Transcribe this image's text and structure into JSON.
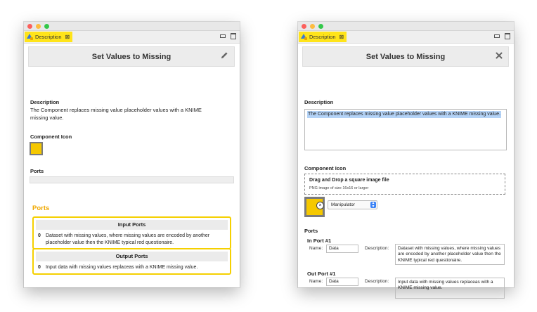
{
  "left_window": {
    "tab": {
      "label": "Description"
    },
    "header": {
      "title": "Set Values to Missing",
      "action_icon": "pencil-icon"
    },
    "description": {
      "label": "Description",
      "text": "The Component replaces missing value placeholder values with a KNIME missing value."
    },
    "component_icon": {
      "label": "Component Icon"
    },
    "ports": {
      "label": "Ports"
    },
    "ports_panel": {
      "title": "Ports",
      "input": {
        "header": "Input Ports",
        "rows": [
          {
            "index": "0",
            "text": "Dataset with missing values, where missing values are encoded by another placeholder value then the KNIME typical red questionaire."
          }
        ]
      },
      "output": {
        "header": "Output Ports",
        "rows": [
          {
            "index": "0",
            "text": "Input data with missing values replaceas with a KNIME missing value."
          }
        ]
      }
    }
  },
  "right_window": {
    "tab": {
      "label": "Description"
    },
    "header": {
      "title": "Set Values to Missing",
      "action_icon": "close-icon"
    },
    "description": {
      "label": "Description",
      "value": "The Component replaces missing value placeholder values with a KNIME missing value."
    },
    "component_icon": {
      "label": "Component Icon",
      "dropzone_title": "Drag and Drop a square image file",
      "dropzone_subtitle": "PNG image of size 16x16 or larger",
      "remove_symbol": "×",
      "type_select": "Manipulator"
    },
    "ports": {
      "label": "Ports",
      "in_port": {
        "title": "In Port #1",
        "name_label": "Name:",
        "name": "Data",
        "description_label": "Description:",
        "description": "Dataset with missing values, where missing values are encoded by another placeholder value then the KNIME typical red questionaire."
      },
      "out_port": {
        "title": "Out Port #1",
        "name_label": "Name:",
        "name": "Data",
        "description_label": "Description:",
        "description": "Input data with missing values replaceas with a KNIME missing value."
      }
    }
  },
  "colors": {
    "tab_highlight": "#ffe41a",
    "ports_accent": "#f0a800",
    "icon_yellow": "#f5c800",
    "selection": "#b4d3f7",
    "select_accent": "#3b82f6"
  }
}
